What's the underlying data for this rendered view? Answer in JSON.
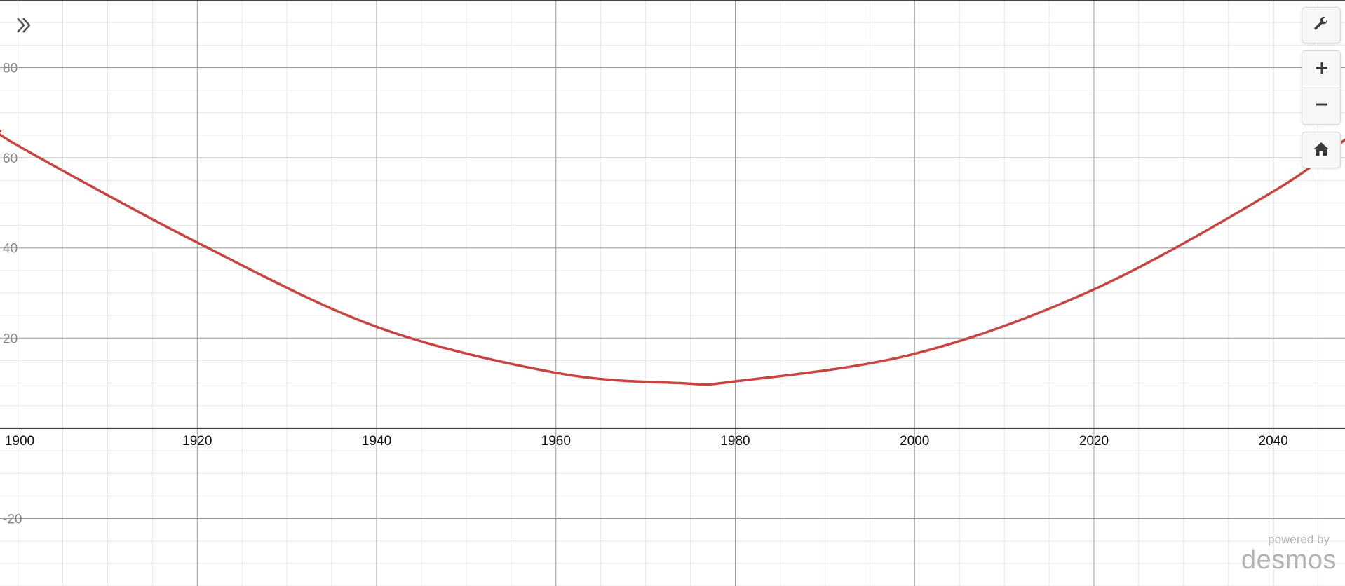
{
  "app": {
    "name": "desmos"
  },
  "controls": {
    "expand_icon": "double-chevron-right-icon",
    "settings_icon": "wrench-icon",
    "zoom_in_icon": "plus-icon",
    "zoom_out_icon": "minus-icon",
    "home_icon": "home-icon"
  },
  "branding": {
    "powered_by": "powered by",
    "logo_text": "desmos"
  },
  "graph": {
    "x_range": [
      1898,
      2048
    ],
    "y_range": [
      -35,
      95
    ],
    "major_step_x": 20,
    "minor_step_x": 5,
    "major_step_y": 20,
    "minor_step_y": 5,
    "x_tick_labels": [
      "1900",
      "1920",
      "1940",
      "1960",
      "1980",
      "2000",
      "2020",
      "2040"
    ],
    "y_tick_labels": [
      "80",
      "60",
      "40",
      "20",
      "-20"
    ],
    "curve_color": "#c74440",
    "curve_points": [
      [
        1898,
        66
      ],
      [
        1900,
        62.7
      ],
      [
        1920,
        41.2
      ],
      [
        1940,
        22.5
      ],
      [
        1960,
        12.3
      ],
      [
        1974,
        10
      ],
      [
        1980,
        10.4
      ],
      [
        2000,
        16.5
      ],
      [
        2020,
        30.8
      ],
      [
        2040,
        52.5
      ],
      [
        2048,
        64
      ]
    ]
  }
}
